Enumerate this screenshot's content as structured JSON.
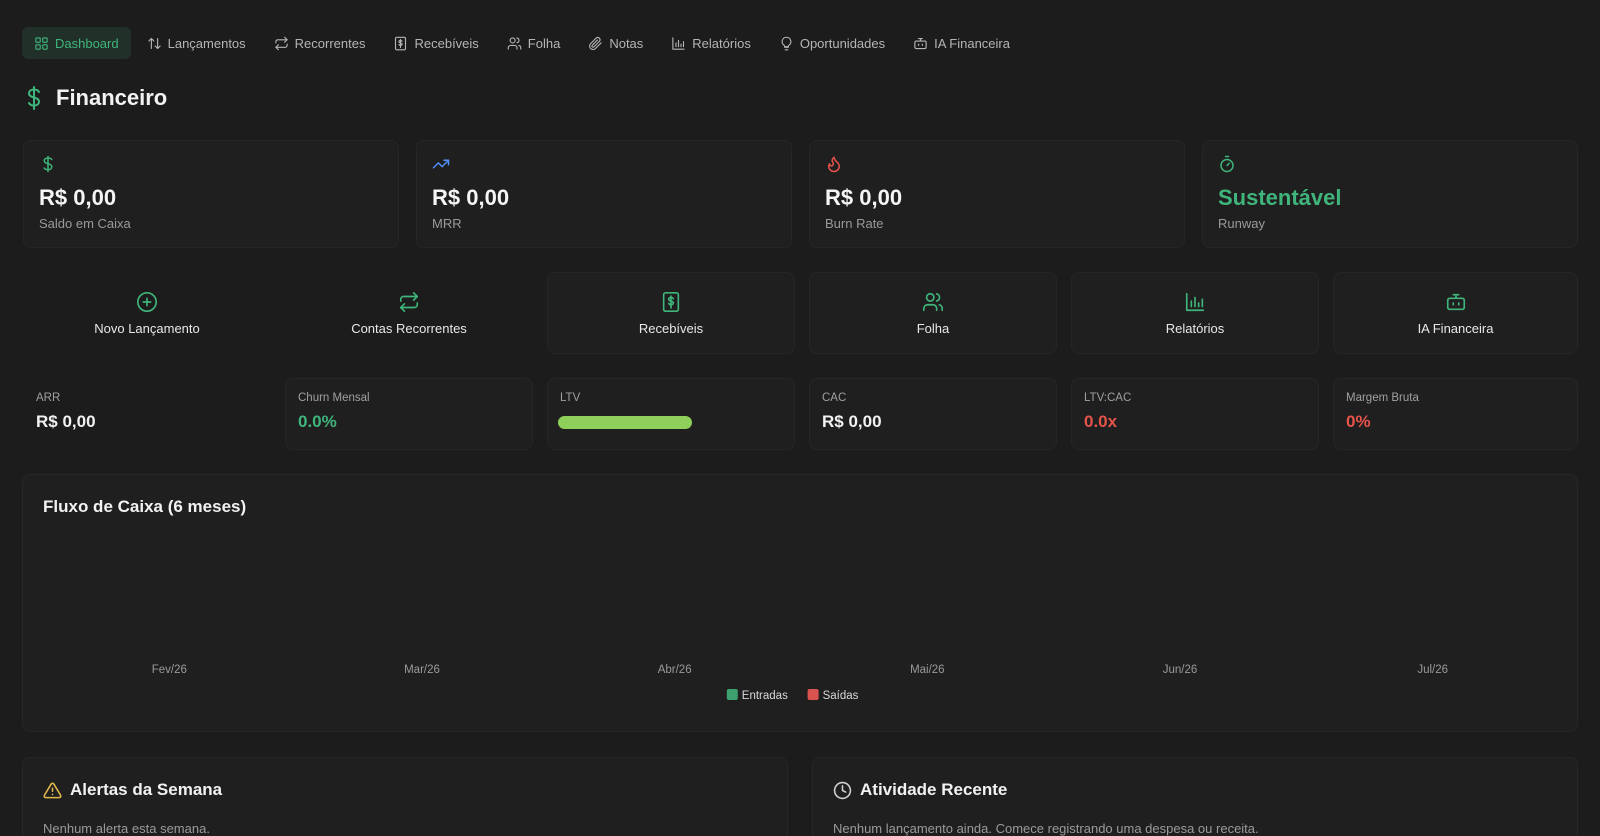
{
  "nav": {
    "items": [
      {
        "label": "Dashboard",
        "icon": "grid-icon",
        "active": true
      },
      {
        "label": "Lançamentos",
        "icon": "arrows-updown-icon"
      },
      {
        "label": "Recorrentes",
        "icon": "repeat-icon"
      },
      {
        "label": "Recebíveis",
        "icon": "receipt-icon"
      },
      {
        "label": "Folha",
        "icon": "users-icon"
      },
      {
        "label": "Notas",
        "icon": "paperclip-icon"
      },
      {
        "label": "Relatórios",
        "icon": "bar-chart-icon"
      },
      {
        "label": "Oportunidades",
        "icon": "lightbulb-icon"
      },
      {
        "label": "IA Financeira",
        "icon": "bot-icon"
      }
    ]
  },
  "page": {
    "title": "Financeiro",
    "icon": "dollar-icon"
  },
  "kpis": [
    {
      "value": "R$ 0,00",
      "label": "Saldo em Caixa",
      "icon": "dollar-icon",
      "color": "#3fb57b"
    },
    {
      "value": "R$ 0,00",
      "label": "MRR",
      "icon": "trending-up-icon",
      "color": "#4f8ff7"
    },
    {
      "value": "R$ 0,00",
      "label": "Burn Rate",
      "icon": "flame-icon",
      "color": "#e5534b"
    },
    {
      "value": "Sustentável",
      "label": "Runway",
      "icon": "timer-icon",
      "color": "#3fb57b"
    }
  ],
  "quick_actions": [
    {
      "label": "Novo Lançamento",
      "icon": "plus-circle-icon"
    },
    {
      "label": "Contas Recorrentes",
      "icon": "repeat-icon"
    },
    {
      "label": "Recebíveis",
      "icon": "receipt-icon"
    },
    {
      "label": "Folha",
      "icon": "users-icon"
    },
    {
      "label": "Relatórios",
      "icon": "bar-chart-icon"
    },
    {
      "label": "IA Financeira",
      "icon": "bot-icon"
    }
  ],
  "metrics": [
    {
      "label": "ARR",
      "value": "R$ 0,00",
      "color": "#f2f2f2"
    },
    {
      "label": "Churn Mensal",
      "value": "0.0%",
      "color": "#3fb57b"
    },
    {
      "label": "LTV",
      "value": "",
      "color": "#8ed05a"
    },
    {
      "label": "CAC",
      "value": "R$ 0,00",
      "color": "#f2f2f2"
    },
    {
      "label": "LTV:CAC",
      "value": "0.0x",
      "color": "#e5534b"
    },
    {
      "label": "Margem Bruta",
      "value": "0%",
      "color": "#e5534b"
    }
  ],
  "cashflow": {
    "title": "Fluxo de Caixa (6 meses)"
  },
  "chart_data": {
    "type": "bar",
    "title": "Fluxo de Caixa (6 meses)",
    "categories": [
      "Fev/26",
      "Mar/26",
      "Abr/26",
      "Mai/26",
      "Jun/26",
      "Jul/26"
    ],
    "series": [
      {
        "name": "Entradas",
        "values": [
          0,
          0,
          0,
          0,
          0,
          0
        ],
        "color": "#3fa06f"
      },
      {
        "name": "Saídas",
        "values": [
          0,
          0,
          0,
          0,
          0,
          0
        ],
        "color": "#d9534f"
      }
    ],
    "legend": "bottom",
    "grid": false
  },
  "alerts": {
    "title": "Alertas da Semana",
    "empty": "Nenhum alerta esta semana.",
    "icon": "warning-icon",
    "color": "#e0b84a"
  },
  "activity": {
    "title": "Atividade Recente",
    "empty": "Nenhum lançamento ainda. Comece registrando uma despesa ou receita.",
    "icon": "clock-icon"
  }
}
